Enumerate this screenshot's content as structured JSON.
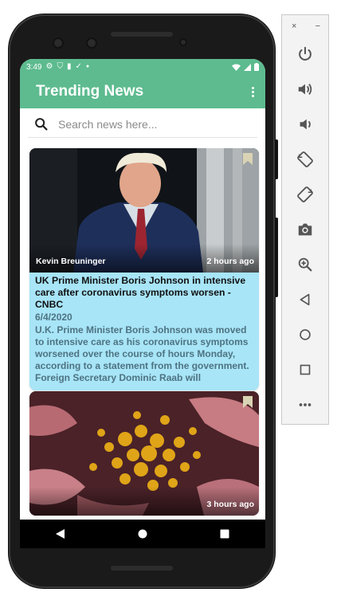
{
  "statusbar": {
    "time": "3:49"
  },
  "toolbar": {
    "title": "Trending News"
  },
  "search": {
    "placeholder": "Search news here..."
  },
  "articles": [
    {
      "author": "Kevin Breuninger",
      "time_ago": "2 hours ago",
      "title": "UK Prime Minister Boris Johnson in intensive care after coronavirus symptoms worsen - CNBC",
      "date": "6/4/2020",
      "description": "U.K. Prime Minister Boris Johnson was moved to intensive care as his coronavirus symptoms worsened over the course of hours Monday, according to a statement from the government. Foreign Secretary Dominic Raab will"
    },
    {
      "author": "",
      "time_ago": "3 hours ago",
      "title": "",
      "date": "",
      "description": ""
    }
  ],
  "emulator": {
    "close_label": "×",
    "minimize_label": "−",
    "tools": [
      "power-icon",
      "volume-up-icon",
      "volume-down-icon",
      "rotate-left-icon",
      "rotate-right-icon",
      "camera-icon",
      "zoom-icon",
      "back-icon",
      "home-icon",
      "overview-icon",
      "more-icon"
    ]
  },
  "colors": {
    "accent": "#5dbb8f",
    "card": "#a7e5f7",
    "card_text": "#4e7382"
  }
}
